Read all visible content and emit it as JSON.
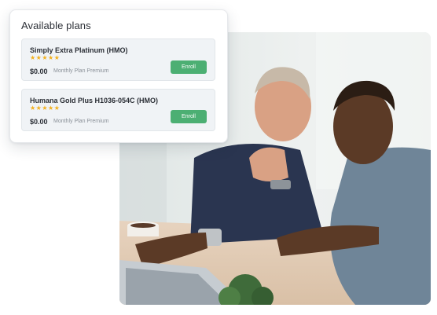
{
  "plans_card": {
    "title": "Available plans",
    "plans": [
      {
        "name": "Simply Extra Platinum (HMO)",
        "rating": 5,
        "stars": "★★★★★",
        "price": "$0.00",
        "price_label": "Monthly Plan Premium",
        "button_label": "Enroll"
      },
      {
        "name": "Humana Gold Plus H1036-054C (HMO)",
        "rating": 5,
        "stars": "★★★★★",
        "price": "$0.00",
        "price_label": "Monthly Plan Premium",
        "button_label": "Enroll"
      }
    ]
  },
  "colors": {
    "accent_green": "#4caf73",
    "star": "#f2b01e",
    "card_row_bg": "#f0f3f6"
  }
}
